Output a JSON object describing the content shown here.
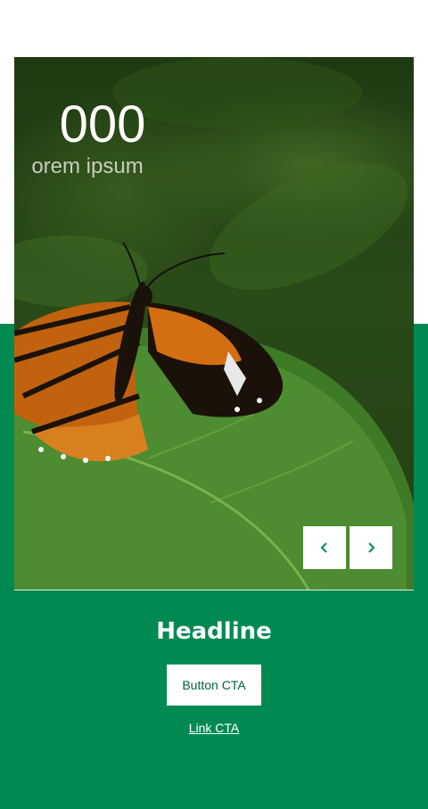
{
  "hero": {
    "stat_number": "000",
    "stat_label": "orem ipsum",
    "image_icon": "monarch-butterfly-on-leaf"
  },
  "carousel": {
    "prev_icon": "chevron-left-icon",
    "next_icon": "chevron-right-icon"
  },
  "section": {
    "headline": "Headline",
    "button_cta": "Button CTA",
    "link_cta": "Link CTA"
  },
  "colors": {
    "brand_green": "#008a52",
    "white": "#ffffff",
    "button_text": "#00643a"
  }
}
